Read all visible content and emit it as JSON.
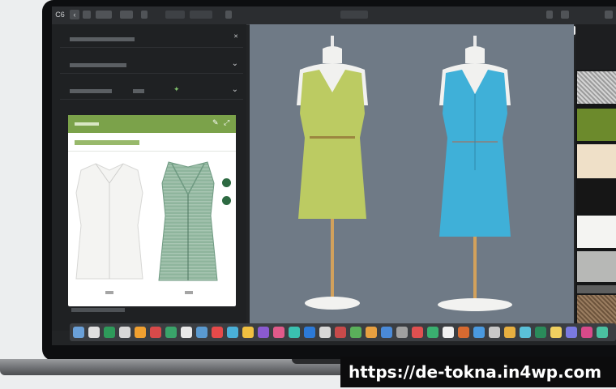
{
  "topbar": {
    "left_label": "C6",
    "center_label": "",
    "search_placeholder": ""
  },
  "left_panel": {
    "rows": [
      {
        "label": ""
      },
      {
        "label": ""
      },
      {
        "label": ""
      }
    ],
    "card": {
      "header": "",
      "subtitle": "",
      "item_labels": [
        "",
        ""
      ]
    },
    "footer": ""
  },
  "url_badge": "https://de-tokna.in4wp.com",
  "colors": {
    "accent": "#7ba24a",
    "canvas": "#6f7a86",
    "dress_left": "#bccb62",
    "dress_right": "#3fb0d8"
  },
  "swatches": [
    {
      "name": "grey-texture",
      "color": "#c9c9c9"
    },
    {
      "name": "olive",
      "color": "#6c8a2c"
    },
    {
      "name": "beige",
      "color": "#efe0c8"
    },
    {
      "name": "black",
      "color": "#161616"
    },
    {
      "name": "white",
      "color": "#f4f4f2"
    },
    {
      "name": "light-grey",
      "color": "#b7b8b6"
    },
    {
      "name": "dark-grey",
      "color": "#5e5f5f"
    },
    {
      "name": "brown-texture",
      "color": "#8a6e54"
    }
  ],
  "dock_icons": [
    "finder-icon",
    "app-icon",
    "app-icon",
    "app-icon",
    "app-icon",
    "app-icon",
    "app-icon",
    "app-icon",
    "app-icon",
    "app-icon",
    "app-icon",
    "app-icon",
    "app-icon",
    "app-icon",
    "app-icon",
    "app-icon",
    "app-icon",
    "app-icon",
    "app-icon",
    "app-icon",
    "app-icon",
    "app-icon",
    "app-icon",
    "app-icon",
    "app-icon",
    "app-icon",
    "app-icon",
    "app-icon",
    "app-icon",
    "app-icon",
    "app-icon",
    "app-icon",
    "app-icon",
    "app-icon",
    "app-icon"
  ]
}
